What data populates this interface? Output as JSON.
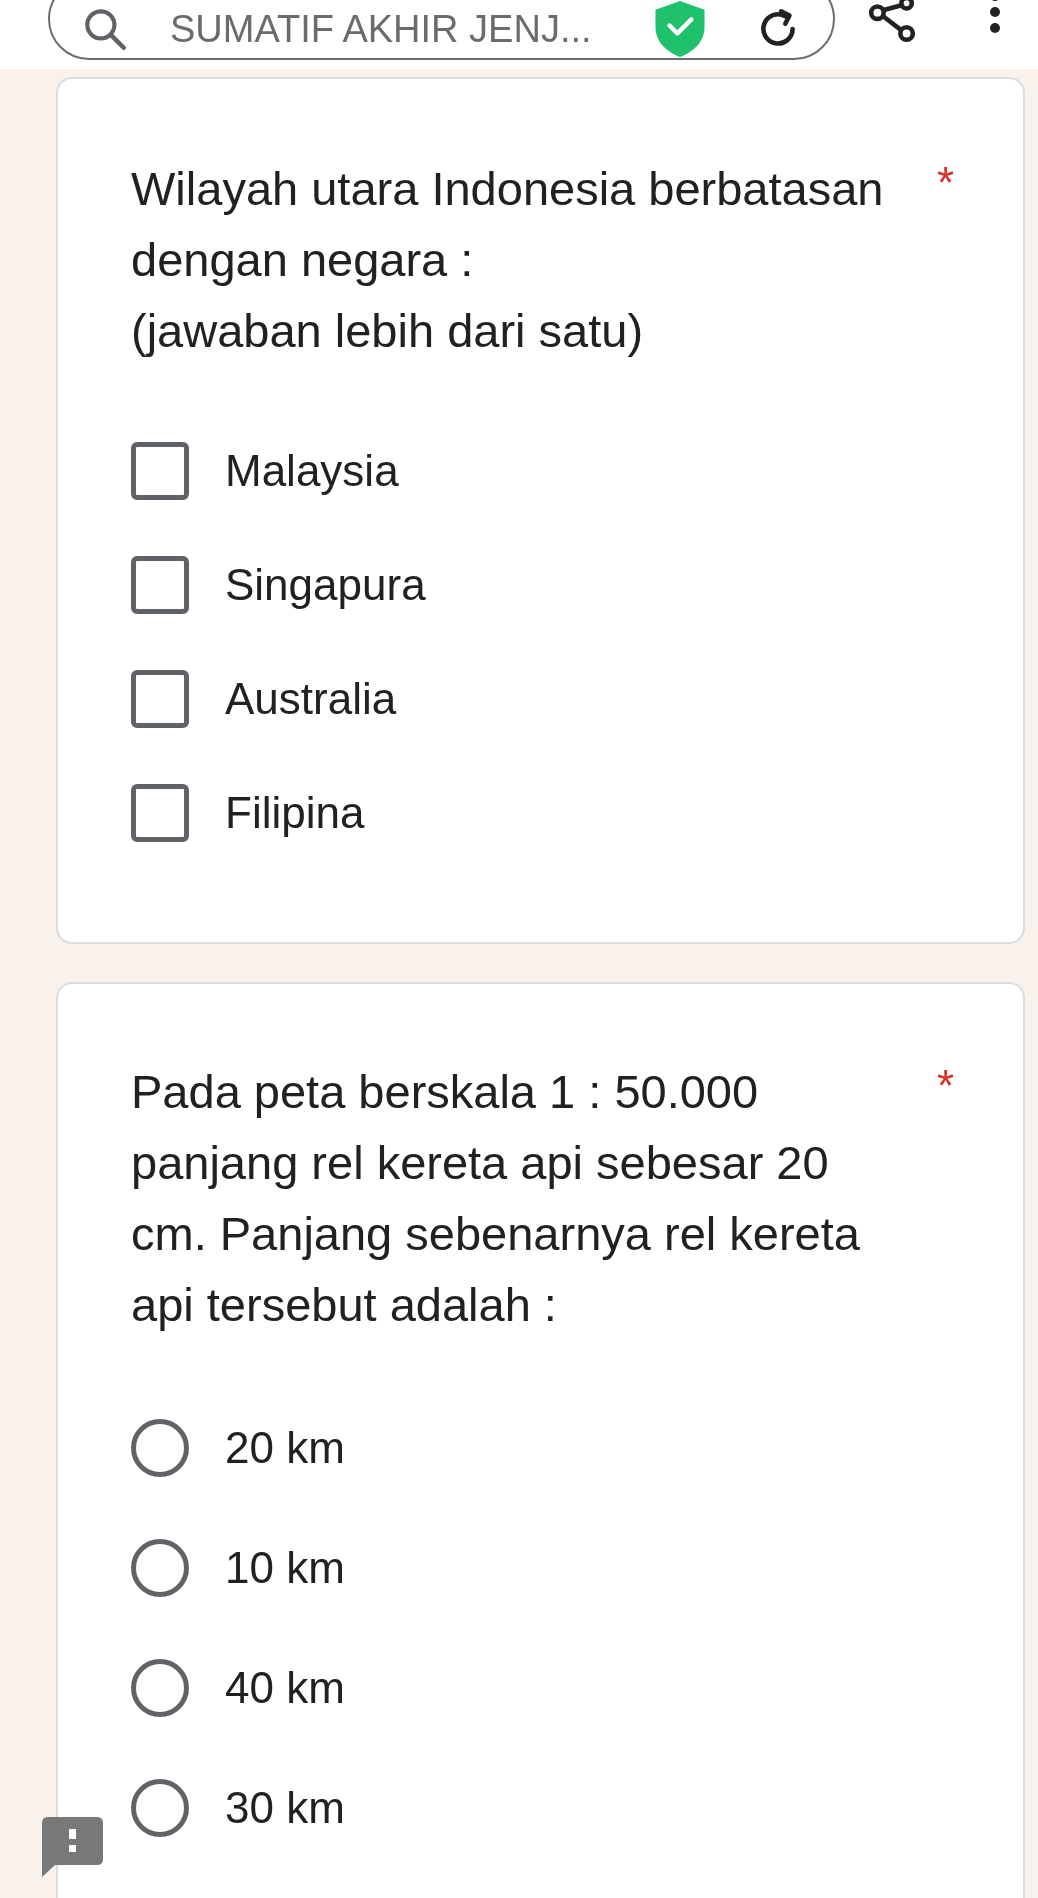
{
  "search_bar": {
    "text": "SUMATIF AKHIR JENJ..."
  },
  "questions": [
    {
      "kind": "checkbox",
      "title": "Wilayah utara Indonesia berbatasan dengan negara :\n(jawaban lebih dari satu)",
      "required_mark": "*",
      "options": [
        {
          "label": "Malaysia",
          "checked": false
        },
        {
          "label": "Singapura",
          "checked": false
        },
        {
          "label": "Australia",
          "checked": false
        },
        {
          "label": "Filipina",
          "checked": false
        }
      ]
    },
    {
      "kind": "radio",
      "title": "Pada peta berskala 1 : 50.000 panjang rel kereta api sebesar 20 cm. Panjang sebenarnya rel kereta api tersebut adalah :",
      "required_mark": "*",
      "options": [
        {
          "label": "20 km",
          "selected": false
        },
        {
          "label": "10 km",
          "selected": false
        },
        {
          "label": "40 km",
          "selected": false
        },
        {
          "label": "30 km",
          "selected": false
        }
      ]
    }
  ]
}
